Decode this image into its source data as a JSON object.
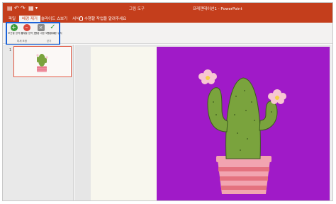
{
  "app": {
    "document_title": "프레젠테이션1 - PowerPoint",
    "context_tab_group": "그림 도구",
    "accent_color": "#c43e1c",
    "highlight_color": "#1b63d8"
  },
  "quick_access": [
    {
      "name": "save-icon",
      "glyph": "💾"
    },
    {
      "name": "undo-icon",
      "glyph": "↶"
    },
    {
      "name": "redo-icon",
      "glyph": "↷"
    },
    {
      "name": "start-from-beginning-icon",
      "glyph": "⊞"
    },
    {
      "name": "customize-quick-access-icon",
      "glyph": "▾"
    }
  ],
  "tabs": [
    {
      "label": "파일",
      "active": false
    },
    {
      "label": "배경 제거",
      "active": true
    },
    {
      "label": "슬라이드 쇼",
      "active": false
    },
    {
      "label": "보기",
      "active": false
    },
    {
      "label": "서식",
      "active": false
    }
  ],
  "tell_me": "수행할 작업을 알려주세요",
  "ribbon": {
    "buttons": [
      {
        "label": "보관할 영역 표시",
        "icon": "mark-keep-icon",
        "color": "#3a9d3a"
      },
      {
        "label": "제거할 영역 표시",
        "icon": "mark-remove-icon",
        "color": "#d9453a"
      },
      {
        "label": "변경 내용 모두 취소",
        "icon": "discard-changes-icon",
        "color": "#7a7a7a"
      },
      {
        "label": "변경 내용 유지",
        "icon": "keep-changes-icon",
        "color": "#3a9d3a"
      }
    ],
    "groups": [
      "미세 조정",
      "닫기"
    ]
  },
  "thumbnails": [
    {
      "number": "1",
      "selected": true
    }
  ],
  "slide": {
    "background_color": "#a01ac8",
    "image_description_icon": "cactus-image"
  }
}
